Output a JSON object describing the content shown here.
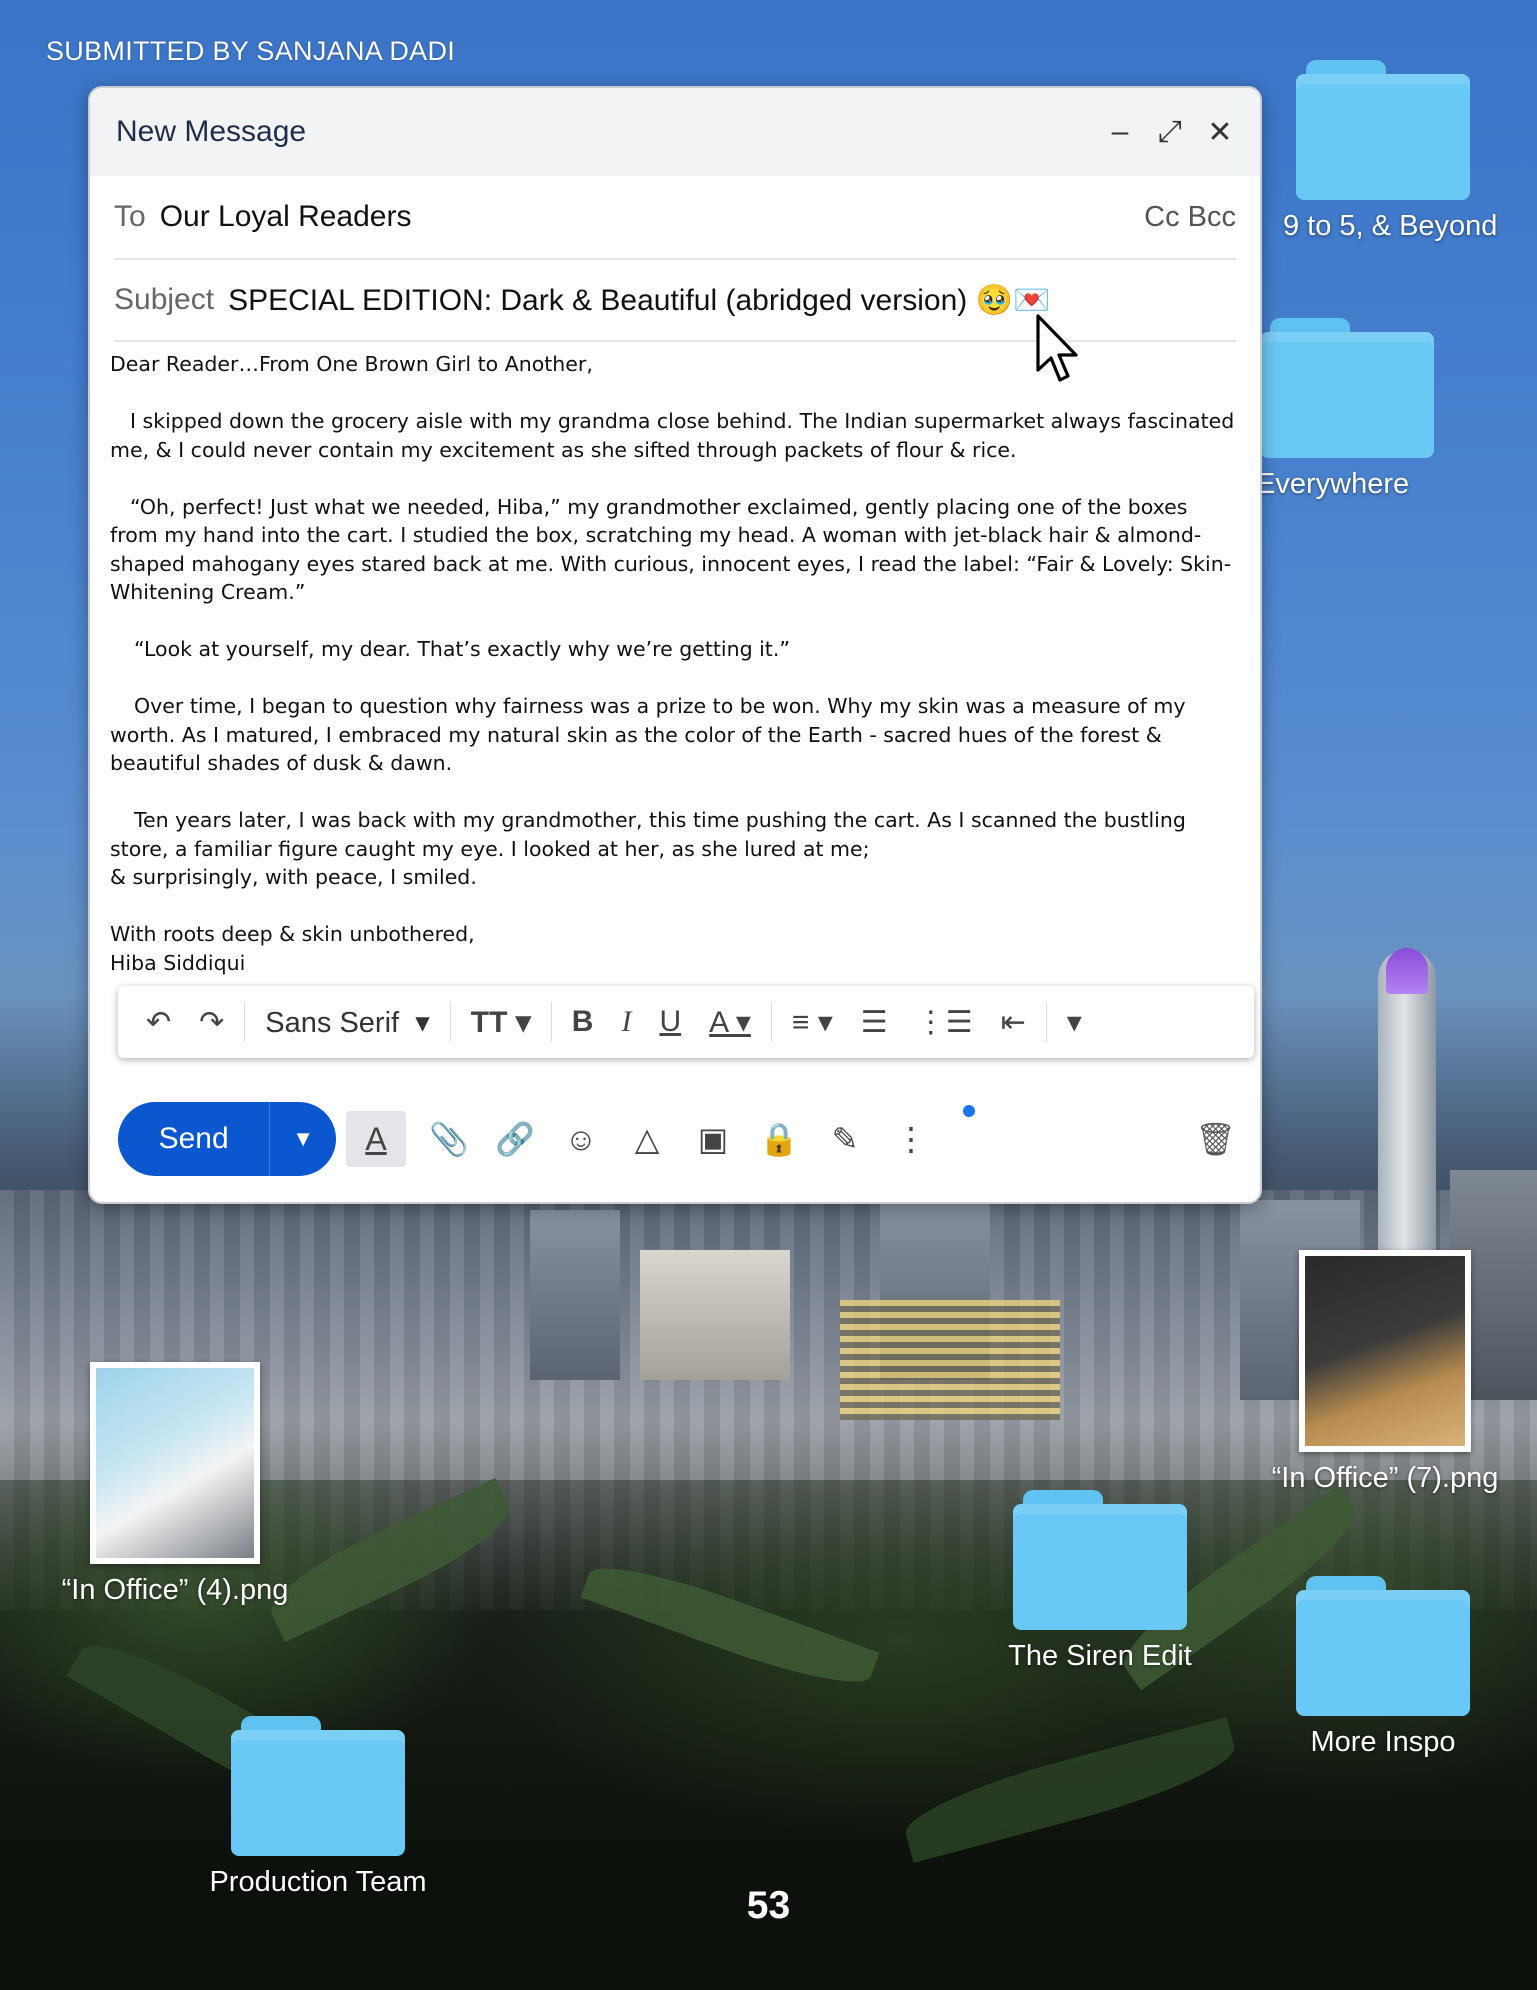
{
  "credit": "SUBMITTED BY SANJANA DADI",
  "compose": {
    "title": "New Message",
    "minimize_icon": "minimize-icon",
    "expand_icon": "expand-icon",
    "close_icon": "close-icon",
    "to_label": "To",
    "to_value": "Our Loyal Readers",
    "cc_bcc": "Cc Bcc",
    "subject_label": "Subject",
    "subject_value": "SPECIAL EDITION: Dark & Beautiful (abridged version) 🥹💌",
    "body": [
      "Dear Reader…From One Brown Girl to Another,",
      "I skipped down the grocery aisle with my grandma close behind. The Indian supermarket always fascinated me, & I could never contain my excitement as she sifted through packets of flour & rice.",
      "“Oh, perfect! Just what we needed, Hiba,” my grandmother exclaimed, gently placing one of the boxes from my hand into the cart. I studied the box, scratching my head. A woman with jet-black hair & almond-shaped mahogany eyes stared back at me. With curious, innocent eyes, I read the label: “Fair & Lovely: Skin-Whitening Cream.”",
      "“Look at yourself, my dear. That’s exactly why we’re getting it.”",
      "Over time, I began to question why fairness was a prize to be won. Why my skin was a measure of my worth. As I matured, I embraced my natural skin as the color of the Earth - sacred hues of the forest & beautiful shades of dusk & dawn.",
      "Ten years later, I was back with my grandmother, this time pushing the cart. As I scanned the bustling store, a familiar figure caught my eye. I looked at her, as she lured at me;",
      "& surprisingly, with peace, I smiled.",
      "With roots deep & skin unbothered,",
      "Hiba Siddiqui"
    ],
    "toolbar": {
      "font": "Sans Serif",
      "icons": [
        "undo-icon",
        "redo-icon",
        "font-size-icon",
        "bold-icon",
        "italic-icon",
        "underline-icon",
        "text-color-icon",
        "align-icon",
        "numbered-list-icon",
        "bulleted-list-icon",
        "indent-less-icon",
        "more-formatting-icon"
      ]
    },
    "send_label": "Send",
    "bottom_icons": [
      "formatting-icon",
      "attach-icon",
      "link-icon",
      "emoji-icon",
      "drive-icon",
      "photo-icon",
      "confidential-icon",
      "signature-icon",
      "more-options-icon",
      "trash-icon"
    ]
  },
  "desktop_icons": [
    {
      "label": "9 to 5, & Beyond",
      "type": "folder"
    },
    {
      "label": "Everywhere",
      "type": "folder"
    },
    {
      "label": "“In Office” (7).png",
      "type": "image"
    },
    {
      "label": "“In Office” (4).png",
      "type": "image"
    },
    {
      "label": "The Siren Edit",
      "type": "folder"
    },
    {
      "label": "More Inspo",
      "type": "folder"
    },
    {
      "label": "Production Team",
      "type": "folder"
    }
  ],
  "page_number": "53",
  "colors": {
    "send_button": "#0b57d0",
    "folder": "#69c8f5",
    "tower_crown": "#8a4bd8"
  }
}
